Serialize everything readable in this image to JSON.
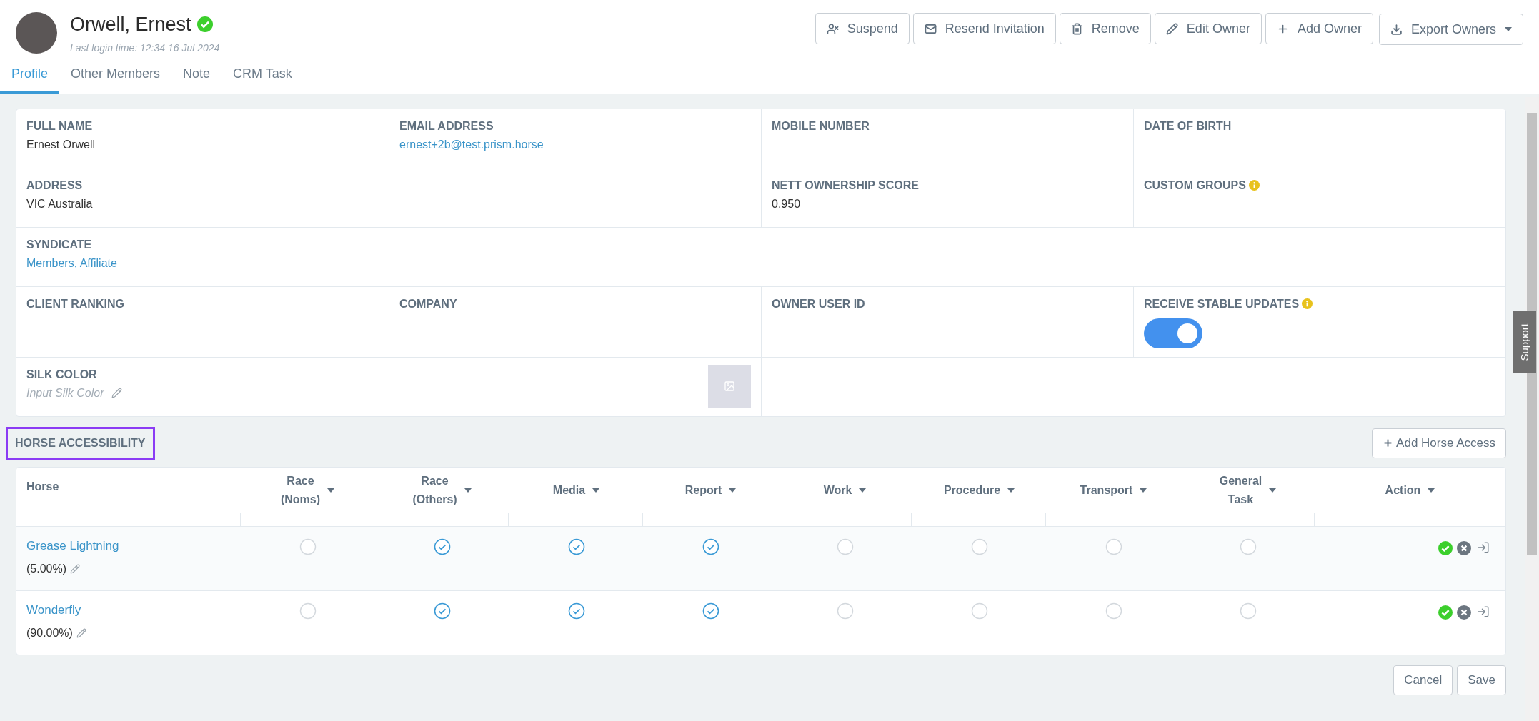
{
  "profile": {
    "name": "Orwell, Ernest",
    "verified": true,
    "last_login": "Last login time: 12:34 16 Jul 2024"
  },
  "header_buttons": [
    {
      "label": "Suspend",
      "dropdown": false
    },
    {
      "label": "Resend Invitation",
      "dropdown": false
    },
    {
      "label": "Remove",
      "dropdown": false
    },
    {
      "label": "Edit Owner",
      "dropdown": false
    },
    {
      "label": "Add Owner",
      "dropdown": false
    },
    {
      "label": "Export Owners",
      "dropdown": true
    }
  ],
  "tabs": [
    {
      "label": "Profile",
      "selected": true
    },
    {
      "label": "Other Members",
      "selected": false
    },
    {
      "label": "Note",
      "selected": false
    },
    {
      "label": "CRM Task",
      "selected": false
    }
  ],
  "fields": [
    [
      {
        "label": "FULL NAME",
        "kind": "text",
        "value": "Ernest Orwell"
      },
      {
        "label": "EMAIL ADDRESS",
        "kind": "link",
        "value": "ernest+2b@test.prism.horse"
      },
      {
        "label": "MOBILE NUMBER",
        "kind": "text"
      },
      {
        "label": "DATE OF BIRTH",
        "kind": "text"
      }
    ],
    [
      {
        "label": "ADDRESS",
        "kind": "text",
        "value": "VIC Australia"
      },
      {
        "label": "NETT OWNERSHIP SCORE",
        "kind": "text",
        "value": "0.950"
      },
      {
        "label": "CUSTOM GROUPS",
        "kind": "text",
        "info": true
      }
    ],
    [
      {
        "label": "SYNDICATE",
        "kind": "link",
        "value": "Members, Affiliate"
      }
    ],
    [
      {
        "label": "CLIENT RANKING",
        "kind": "text"
      },
      {
        "label": "COMPANY",
        "kind": "text"
      },
      {
        "label": "OWNER USER ID",
        "kind": "text"
      },
      {
        "label": "RECEIVE STABLE UPDATES",
        "kind": "toggle",
        "info": true,
        "on": true
      }
    ],
    [
      {
        "label": "SILK COLOR",
        "kind": "silk",
        "placeholder": "Input Silk Color"
      },
      {
        "kind": "empty"
      }
    ]
  ],
  "horse_access": {
    "title": "HORSE ACCESSIBILITY",
    "add_button": "Add Horse Access",
    "columns": [
      {
        "label": [
          "Horse"
        ],
        "sortable": false
      },
      {
        "label": [
          "Race",
          "(Noms)"
        ],
        "sortable": true
      },
      {
        "label": [
          "Race",
          "(Others)"
        ],
        "sortable": true
      },
      {
        "label": [
          "Media"
        ],
        "sortable": true
      },
      {
        "label": [
          "Report"
        ],
        "sortable": true
      },
      {
        "label": [
          "Work"
        ],
        "sortable": true
      },
      {
        "label": [
          "Procedure"
        ],
        "sortable": true
      },
      {
        "label": [
          "Transport"
        ],
        "sortable": true
      },
      {
        "label": [
          "General",
          "Task"
        ],
        "sortable": true
      },
      {
        "label": [
          "Action"
        ],
        "sortable": true
      }
    ],
    "rows": [
      {
        "horse": "Grease Lightning",
        "share": "(5.00%)",
        "permissions": [
          false,
          true,
          true,
          true,
          false,
          false,
          false,
          false
        ]
      },
      {
        "horse": "Wonderfly",
        "share": "(90.00%)",
        "permissions": [
          false,
          true,
          true,
          true,
          false,
          false,
          false,
          false
        ]
      }
    ]
  },
  "footer_buttons": [
    "Cancel",
    "Save"
  ],
  "support_tab": "Support"
}
